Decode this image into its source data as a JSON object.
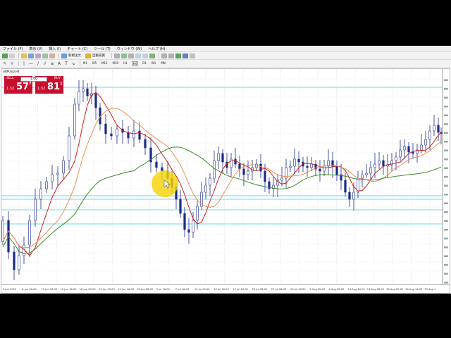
{
  "menu": [
    "ファイル (F)",
    "表示 (V)",
    "挿入 (I)",
    "チャート (C)",
    "ツール (T)",
    "ウィンドウ (W)",
    "ヘルプ (H)"
  ],
  "toolbar": {
    "new_order_label": "新規注文",
    "auto_trading_label": "自動売買"
  },
  "timeframes": [
    "M1",
    "M5",
    "M15",
    "M30",
    "H1",
    "H4",
    "D1",
    "W1",
    "MN"
  ],
  "active_timeframe": "H4",
  "chart": {
    "symbol_title": "GBPUSD,H4",
    "one_click": {
      "sell_label": "SELL",
      "buy_label": "BUY",
      "lot": "1.00",
      "sell_small": "1.32",
      "sell_big": "57",
      "sell_sup": "7",
      "buy_small": "1.32",
      "buy_big": "81",
      "buy_sup": "1"
    },
    "x_labels": [
      "2 Jun 2015",
      "8 Jun 00:00",
      "11 Jun 16:00",
      "16 Jun 16:00",
      "18 Jun 00:00",
      "23 Jun 00:00",
      "25 Jun 16:00",
      "30 Jun 08:00",
      "3 Jul 16:00",
      "7 Jul 16:00",
      "10 Jul 00:00",
      "15 Jul 16:00",
      "17 Jul 16:00",
      "22 Jul 08:00",
      "27 Jul 08:00",
      "29 Jul 16:00",
      "3 Aug 00:00",
      "6 Aug 08:00",
      "10 Aug 16:00",
      "13 Aug 08:00",
      "18 Aug 00:00",
      "20 Aug 16:00",
      "25 Aug 1"
    ],
    "colors": {
      "candle": "#1a2a8a",
      "ma_fast": "#d0201a",
      "ma_mid": "#e8905a",
      "ma_slow": "#3a8a2a",
      "h_lines": "#6fd8e8",
      "highlight": "#f5d400"
    }
  }
}
